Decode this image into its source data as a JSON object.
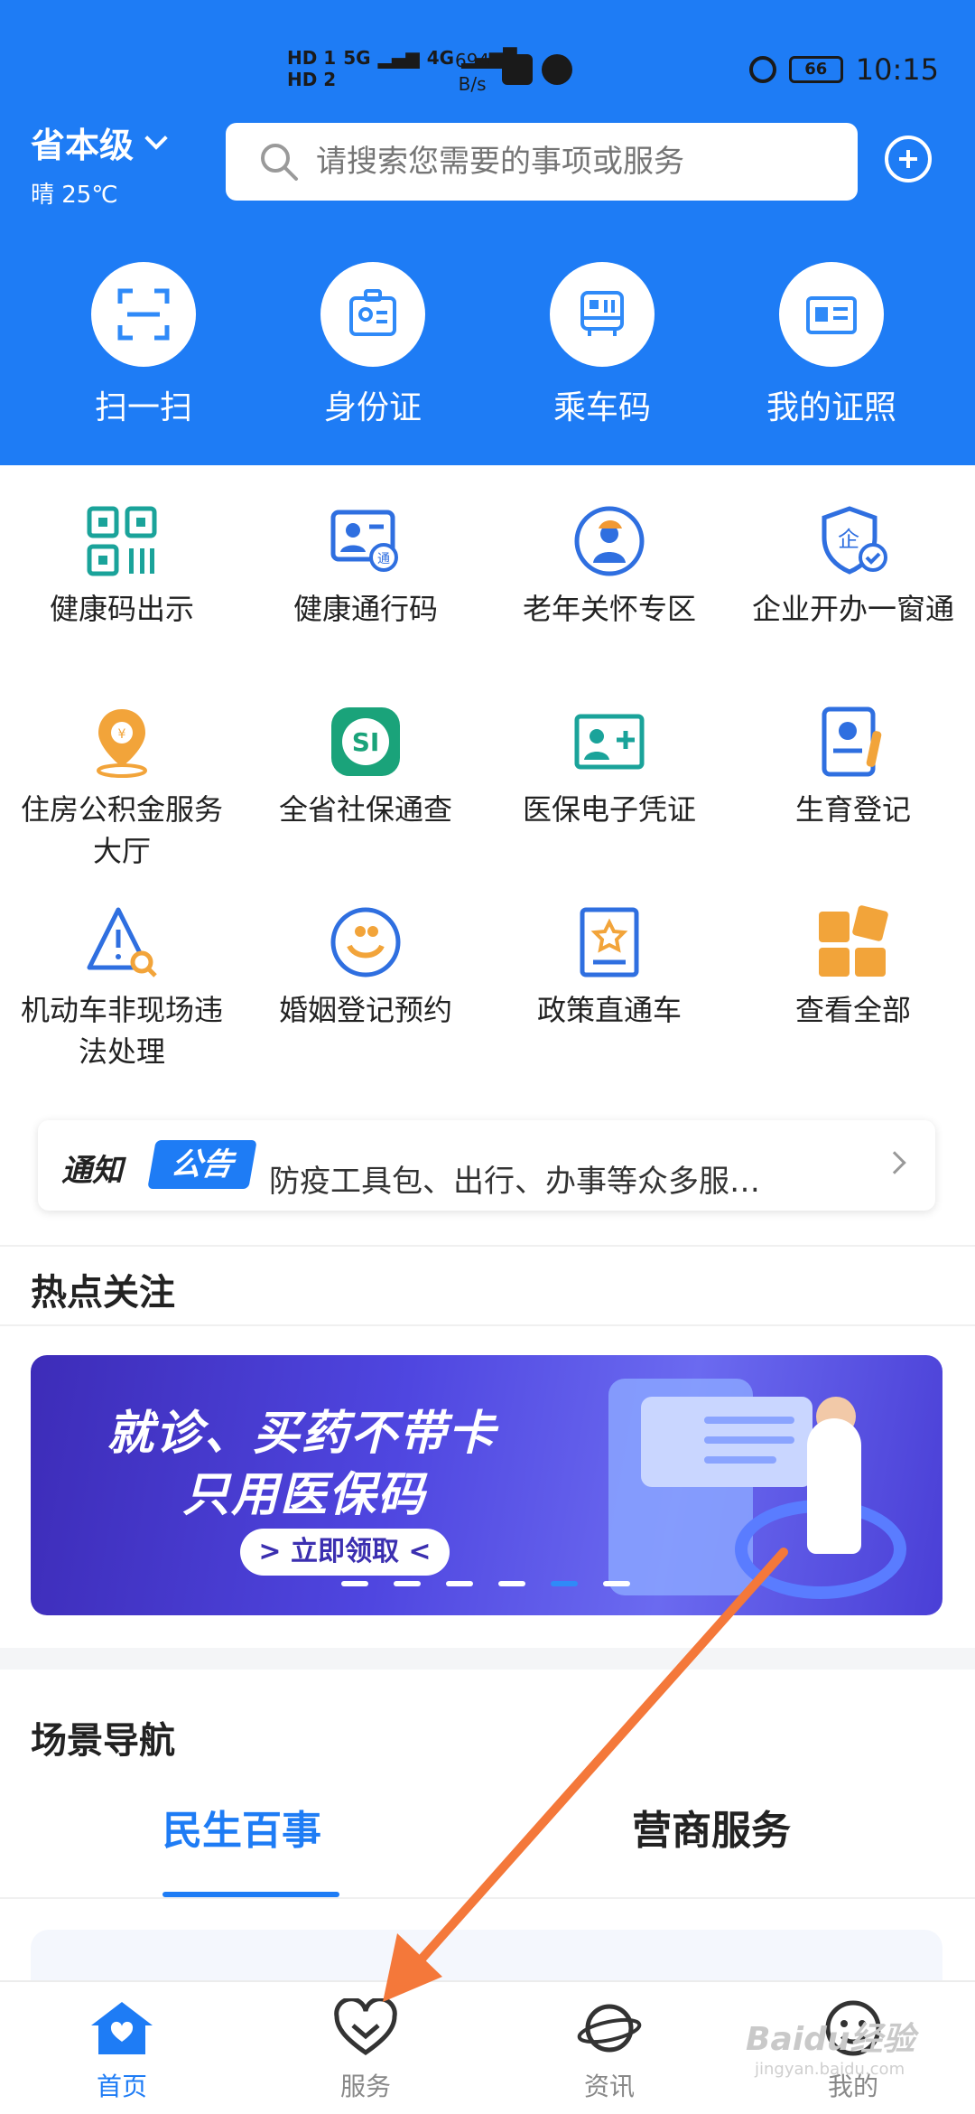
{
  "status_bar": {
    "network_1": "HD 1",
    "network_2": "HD 2",
    "signal_1": "5G",
    "signal_2": "4G",
    "speed_value": "694",
    "speed_unit": "B/s",
    "battery": "66",
    "time": "10:15"
  },
  "header": {
    "location": "省本级",
    "weather": "晴 25℃",
    "search_placeholder": "请搜索您需要的事项或服务"
  },
  "quick_actions": [
    {
      "label": "扫一扫",
      "icon": "scan-icon"
    },
    {
      "label": "身份证",
      "icon": "id-card-icon"
    },
    {
      "label": "乘车码",
      "icon": "bus-code-icon"
    },
    {
      "label": "我的证照",
      "icon": "license-icon"
    }
  ],
  "services": [
    {
      "label": "健康码出示",
      "icon": "qr-code-icon"
    },
    {
      "label": "健康通行码",
      "icon": "health-pass-icon"
    },
    {
      "label": "老年关怀专区",
      "icon": "elderly-care-icon"
    },
    {
      "label": "企业开办一窗通",
      "icon": "enterprise-shield-icon"
    },
    {
      "label": "住房公积金服务大厅",
      "icon": "housing-fund-icon"
    },
    {
      "label": "全省社保通查",
      "icon": "social-security-icon"
    },
    {
      "label": "医保电子凭证",
      "icon": "medical-insurance-icon"
    },
    {
      "label": "生育登记",
      "icon": "birth-registration-icon"
    },
    {
      "label": "机动车非现场违法处理",
      "icon": "traffic-violation-icon"
    },
    {
      "label": "婚姻登记预约",
      "icon": "marriage-icon"
    },
    {
      "label": "政策直通车",
      "icon": "policy-icon"
    },
    {
      "label": "查看全部",
      "icon": "view-all-icon"
    }
  ],
  "notice": {
    "tag": "通知",
    "badge": "公告",
    "text": "防疫工具包、出行、办事等众多服…"
  },
  "hot_topics": {
    "title": "热点关注",
    "banner_line1": "就诊、买药不带卡",
    "banner_line2": "只用医保码",
    "banner_button": "> 立即领取 <",
    "slides": 6,
    "active_slide": 5
  },
  "scene_nav": {
    "title": "场景导航",
    "tabs": [
      "民生百事",
      "营商服务"
    ],
    "active_tab": 0
  },
  "bottom_nav": [
    {
      "label": "首页",
      "icon": "home-icon",
      "active": true
    },
    {
      "label": "服务",
      "icon": "heart-icon",
      "active": false
    },
    {
      "label": "资讯",
      "icon": "planet-icon",
      "active": false
    },
    {
      "label": "我的",
      "icon": "smiley-icon",
      "active": false
    }
  ],
  "watermark": "Baidu经验",
  "watermark_sub": "jingyan.baidu.com",
  "colors": {
    "brand_blue": "#1e7cf5",
    "annotation_arrow": "#f4783a"
  }
}
